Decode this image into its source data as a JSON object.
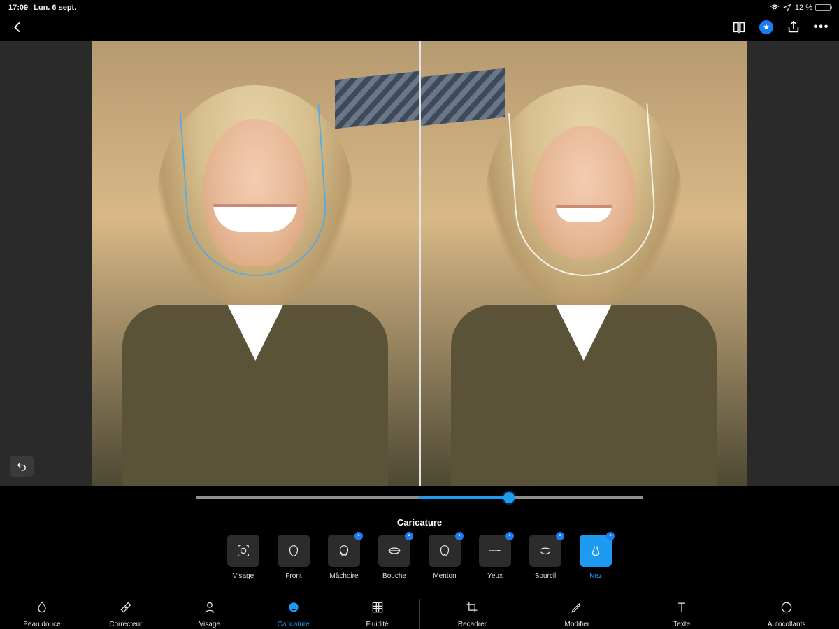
{
  "status": {
    "time": "17:09",
    "date": "Lun. 6 sept.",
    "battery_text": "12 %",
    "battery_pct": 12
  },
  "colors": {
    "accent": "#1d9bf0",
    "premium": "#1d7cf2"
  },
  "slider": {
    "value": 70,
    "min": 0,
    "max": 100,
    "center": 50
  },
  "panel": {
    "title": "Caricature"
  },
  "presets": [
    {
      "id": "visage",
      "label": "Visage",
      "icon": "face-detect-icon",
      "badge": false,
      "active": false
    },
    {
      "id": "front",
      "label": "Front",
      "icon": "face-outline-icon",
      "badge": false,
      "active": false
    },
    {
      "id": "machoire",
      "label": "Mâchoire",
      "icon": "jaw-icon",
      "badge": true,
      "active": false
    },
    {
      "id": "bouche",
      "label": "Bouche",
      "icon": "lips-icon",
      "badge": true,
      "active": false
    },
    {
      "id": "menton",
      "label": "Menton",
      "icon": "chin-icon",
      "badge": true,
      "active": false
    },
    {
      "id": "yeux",
      "label": "Yeux",
      "icon": "eyes-icon",
      "badge": true,
      "active": false
    },
    {
      "id": "sourcil",
      "label": "Sourcil",
      "icon": "eyebrow-icon",
      "badge": true,
      "active": false
    },
    {
      "id": "nez",
      "label": "Nez",
      "icon": "nose-icon",
      "badge": true,
      "active": true
    }
  ],
  "tools_left": [
    {
      "id": "peau",
      "label": "Peau douce",
      "icon": "drop-icon",
      "active": false
    },
    {
      "id": "correcteur",
      "label": "Correcteur",
      "icon": "bandaid-icon",
      "active": false
    },
    {
      "id": "visage",
      "label": "Visage",
      "icon": "person-icon",
      "active": false
    },
    {
      "id": "caricature",
      "label": "Caricature",
      "icon": "mask-icon",
      "active": true
    },
    {
      "id": "fluidite",
      "label": "Fluidité",
      "icon": "grid-icon",
      "active": false
    }
  ],
  "tools_right": [
    {
      "id": "recadrer",
      "label": "Recadrer",
      "icon": "crop-icon",
      "active": false
    },
    {
      "id": "modifier",
      "label": "Modifier",
      "icon": "pencil-icon",
      "active": false
    },
    {
      "id": "texte",
      "label": "Texte",
      "icon": "text-icon",
      "active": false
    },
    {
      "id": "autocollants",
      "label": "Autocollants",
      "icon": "sticker-icon",
      "active": false
    }
  ]
}
